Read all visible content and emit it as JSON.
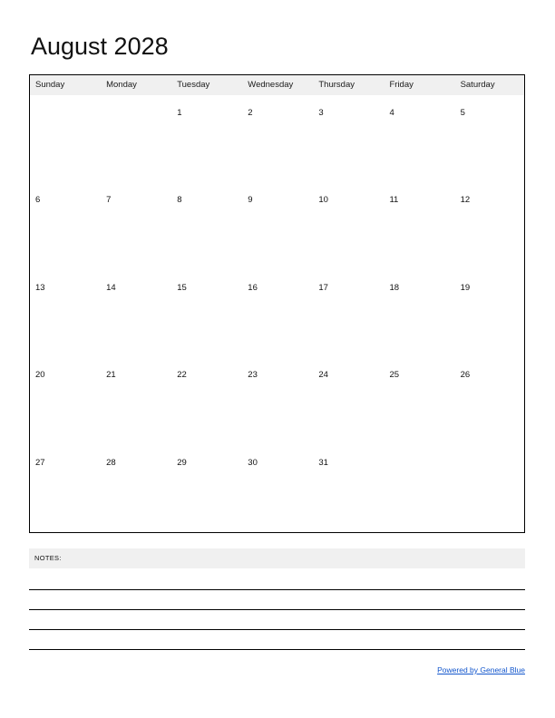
{
  "document": {
    "title": "August 2028",
    "month": "August",
    "year": "2028"
  },
  "calendar": {
    "weekday_headers": [
      "Sunday",
      "Monday",
      "Tuesday",
      "Wednesday",
      "Thursday",
      "Friday",
      "Saturday"
    ],
    "weeks": [
      [
        "",
        "",
        "1",
        "2",
        "3",
        "4",
        "5"
      ],
      [
        "6",
        "7",
        "8",
        "9",
        "10",
        "11",
        "12"
      ],
      [
        "13",
        "14",
        "15",
        "16",
        "17",
        "18",
        "19"
      ],
      [
        "20",
        "21",
        "22",
        "23",
        "24",
        "25",
        "26"
      ],
      [
        "27",
        "28",
        "29",
        "30",
        "31",
        "",
        ""
      ]
    ]
  },
  "notes": {
    "label": "NOTES:",
    "line_count": 4
  },
  "footer": {
    "link_text": "Powered by General Blue"
  },
  "colors": {
    "header_band": "#f0f0f0",
    "grid_border": "#000000",
    "text": "#111111",
    "link": "#1155cc"
  }
}
